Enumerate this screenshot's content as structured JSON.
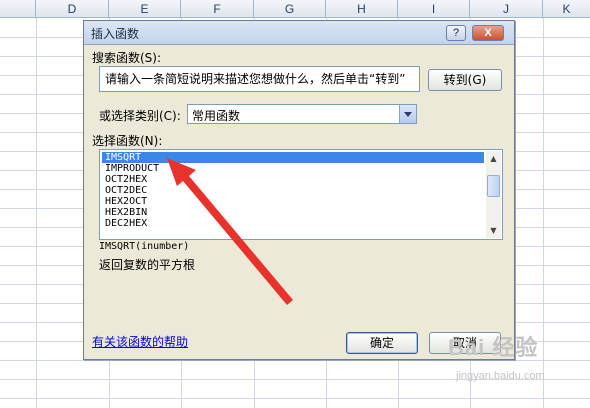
{
  "spreadsheet": {
    "columns": [
      "D",
      "E",
      "F",
      "G",
      "H",
      "I",
      "J",
      "K"
    ]
  },
  "dialog": {
    "title": "插入函数",
    "help_button": "?",
    "close_button": "X",
    "search_label": "搜索函数(S):",
    "search_value": "请输入一条简短说明来描述您想做什么，然后单击“转到”",
    "go_button": "转到(G)",
    "category_label": "或选择类别(C):",
    "category_value": "常用函数",
    "function_label": "选择函数(N):",
    "functions": [
      "IMSQRT",
      "IMPRODUCT",
      "OCT2HEX",
      "OCT2DEC",
      "HEX2OCT",
      "HEX2BIN",
      "DEC2HEX"
    ],
    "selected_function": "IMSQRT",
    "syntax": "IMSQRT(inumber)",
    "description": "返回复数的平方根",
    "help_link": "有关该函数的帮助",
    "ok_button": "确定",
    "cancel_button": "取消"
  },
  "watermark": {
    "main": "Bai 经验",
    "sub": "jingyan.baidu.com"
  },
  "colors": {
    "selection": "#3d86e8",
    "arrow": "#e8322c",
    "link": "#0000ee"
  }
}
